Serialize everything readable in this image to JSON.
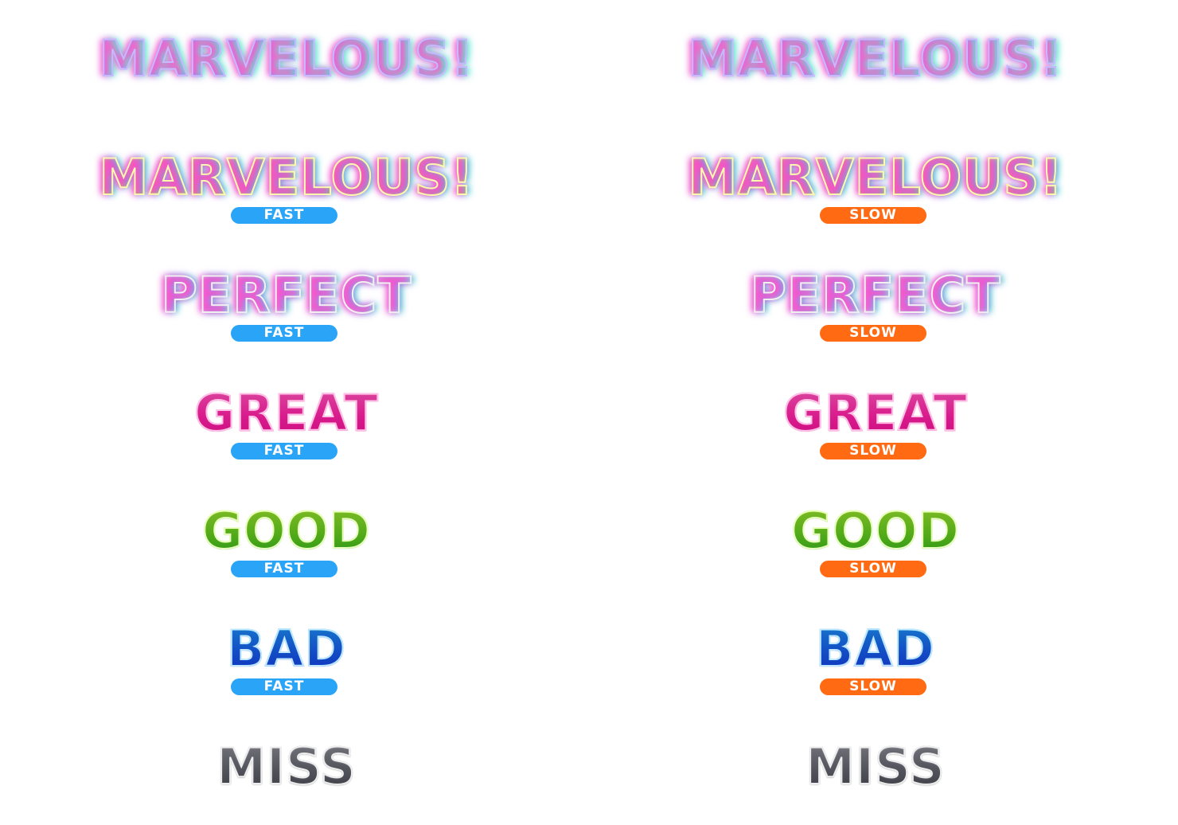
{
  "colors": {
    "fast_badge": "#2aa4f7",
    "slow_badge": "#ff6a12",
    "background": "#ffffff"
  },
  "left": {
    "marvelous_plain": "MARVELOUS!",
    "marvelous": "MARVELOUS!",
    "perfect": "PERFECT",
    "great": "GREAT",
    "good": "GOOD",
    "bad": "BAD",
    "miss": "MISS",
    "timing": "FAST"
  },
  "right": {
    "marvelous_plain": "MARVELOUS!",
    "marvelous": "MARVELOUS!",
    "perfect": "PERFECT",
    "great": "GREAT",
    "good": "GOOD",
    "bad": "BAD",
    "miss": "MISS",
    "timing": "SLOW"
  }
}
